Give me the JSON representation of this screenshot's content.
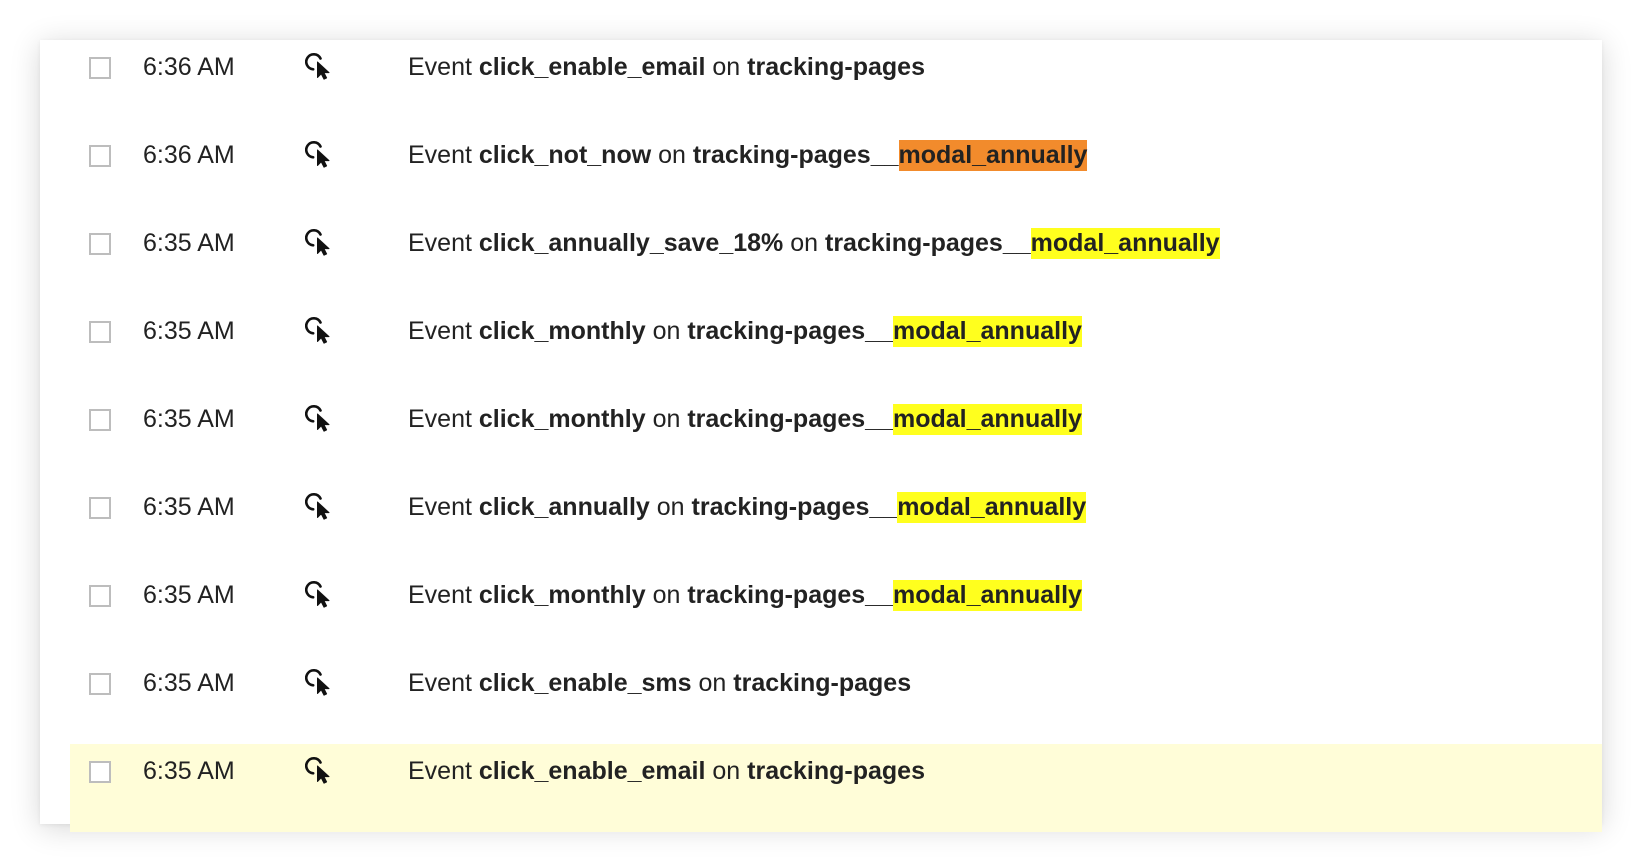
{
  "events": [
    {
      "time": "6:36 AM",
      "prefix": "Event",
      "event": "click_enable_email",
      "on": "on",
      "page": "tracking-pages",
      "suffix": "",
      "highlight_color": "",
      "icon": "click-cursor-icon",
      "selected": false
    },
    {
      "time": "6:36 AM",
      "prefix": "Event",
      "event": "click_not_now",
      "on": "on",
      "page": "tracking-pages__",
      "suffix": "modal_annually",
      "highlight_color": "#f28b2c",
      "icon": "click-cursor-icon",
      "selected": false
    },
    {
      "time": "6:35 AM",
      "prefix": "Event",
      "event": "click_annually_save_18%",
      "on": "on",
      "page": "tracking-pages__",
      "suffix": "modal_annually",
      "highlight_color": "#ffff1e",
      "icon": "click-cursor-icon",
      "selected": false
    },
    {
      "time": "6:35 AM",
      "prefix": "Event",
      "event": "click_monthly",
      "on": "on",
      "page": "tracking-pages__",
      "suffix": "modal_annually",
      "highlight_color": "#ffff1e",
      "icon": "click-cursor-icon",
      "selected": false
    },
    {
      "time": "6:35 AM",
      "prefix": "Event",
      "event": "click_monthly",
      "on": "on",
      "page": "tracking-pages__",
      "suffix": "modal_annually",
      "highlight_color": "#ffff1e",
      "icon": "click-cursor-icon",
      "selected": false
    },
    {
      "time": "6:35 AM",
      "prefix": "Event",
      "event": "click_annually",
      "on": "on",
      "page": "tracking-pages__",
      "suffix": "modal_annually",
      "highlight_color": "#ffff1e",
      "icon": "click-cursor-icon",
      "selected": false
    },
    {
      "time": "6:35 AM",
      "prefix": "Event",
      "event": "click_monthly",
      "on": "on",
      "page": "tracking-pages__",
      "suffix": "modal_annually",
      "highlight_color": "#ffff1e",
      "icon": "click-cursor-icon",
      "selected": false
    },
    {
      "time": "6:35 AM",
      "prefix": "Event",
      "event": "click_enable_sms",
      "on": "on",
      "page": "tracking-pages",
      "suffix": "",
      "highlight_color": "",
      "icon": "click-cursor-icon",
      "selected": false
    },
    {
      "time": "6:35 AM",
      "prefix": "Event",
      "event": "click_enable_email",
      "on": "on",
      "page": "tracking-pages",
      "suffix": "",
      "highlight_color": "",
      "icon": "click-cursor-icon",
      "selected": false,
      "row_highlighted": true
    }
  ],
  "colors": {
    "row_highlight": "#fffdd8",
    "orange_highlight": "#f28b2c",
    "yellow_highlight": "#ffff1e",
    "text": "#222222",
    "checkbox_border": "#bdbdbd"
  }
}
